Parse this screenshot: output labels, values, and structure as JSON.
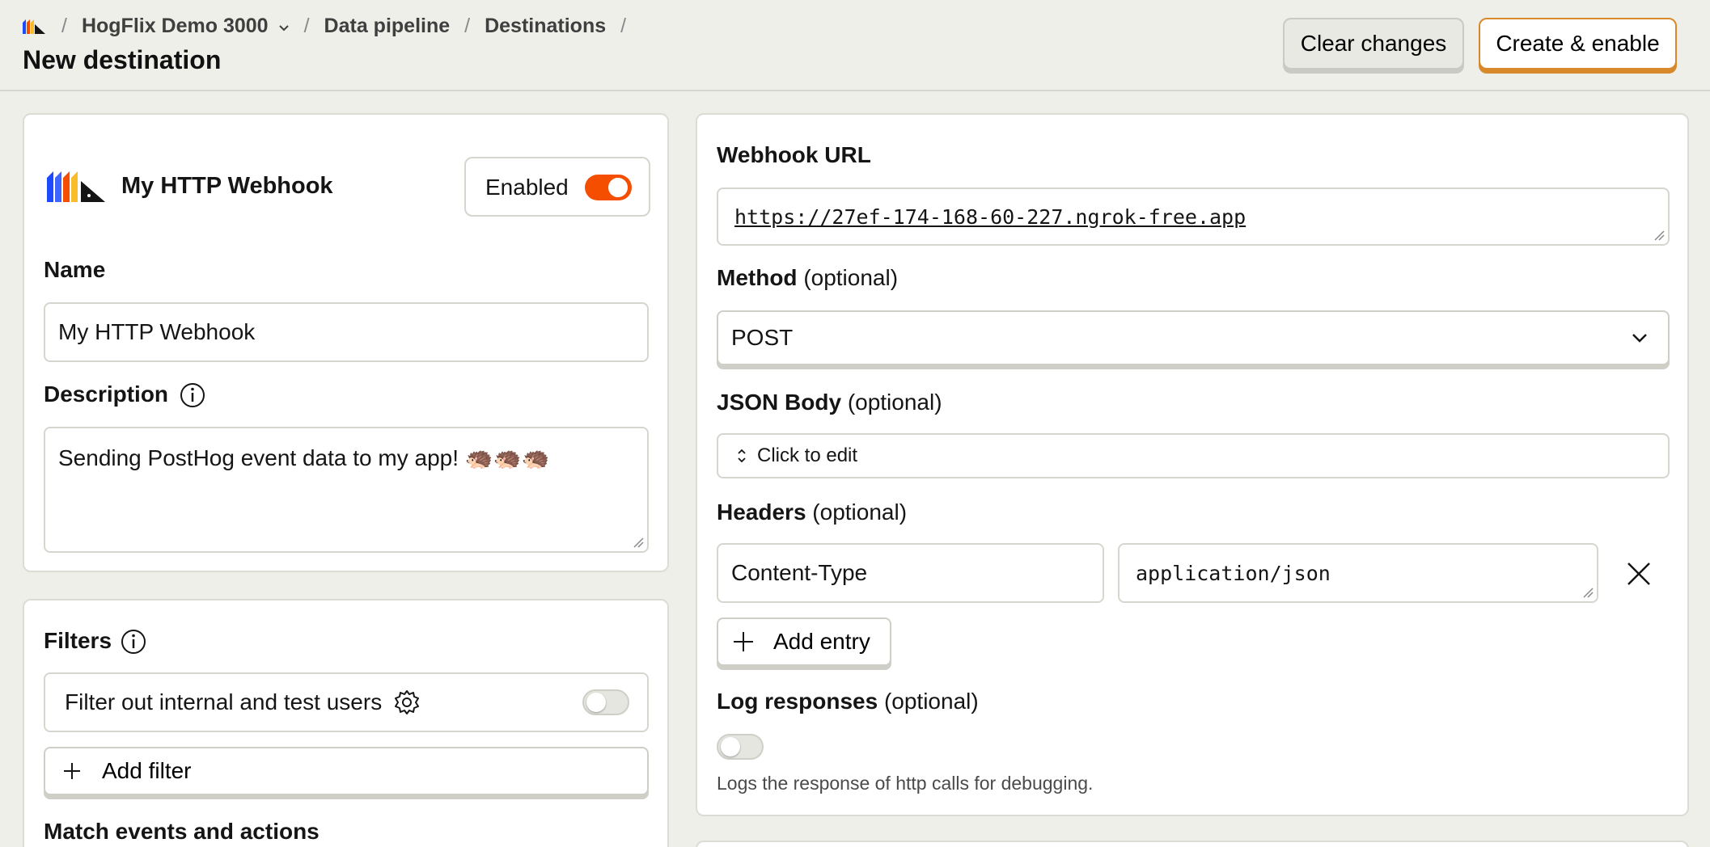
{
  "breadcrumbs": {
    "project": "HogFlix Demo 3000",
    "pipeline": "Data pipeline",
    "destinations": "Destinations",
    "separator": "/"
  },
  "page_title": "New destination",
  "actions": {
    "clear_label": "Clear changes",
    "create_label": "Create & enable"
  },
  "destination": {
    "display_name": "My HTTP Webhook",
    "enabled_label": "Enabled",
    "enabled": true,
    "name_label": "Name",
    "name_value": "My HTTP Webhook",
    "description_label": "Description",
    "description_value": "Sending PostHog event data to my app! 🦔🦔🦔"
  },
  "filters": {
    "title": "Filters",
    "internal_label": "Filter out internal and test users",
    "internal_enabled": false,
    "add_filter_label": "Add filter",
    "match_title": "Match events and actions"
  },
  "config": {
    "webhook_label": "Webhook URL",
    "webhook_value": "https://27ef-174-168-60-227.ngrok-free.app",
    "method_label": "Method",
    "method_opt": "(optional)",
    "method_value": "POST",
    "json_label": "JSON Body",
    "json_opt": "(optional)",
    "json_placeholder": "Click to edit",
    "headers_label": "Headers",
    "headers_opt": "(optional)",
    "header_key": "Content-Type",
    "header_value": "application/json",
    "add_entry_label": "Add entry",
    "log_label": "Log responses",
    "log_opt": "(optional)",
    "log_enabled": false,
    "log_help": "Logs the response of http calls for debugging."
  },
  "colors": {
    "accent": "#f54e00",
    "primary_border": "#d7892b",
    "background": "#eeefe9"
  }
}
